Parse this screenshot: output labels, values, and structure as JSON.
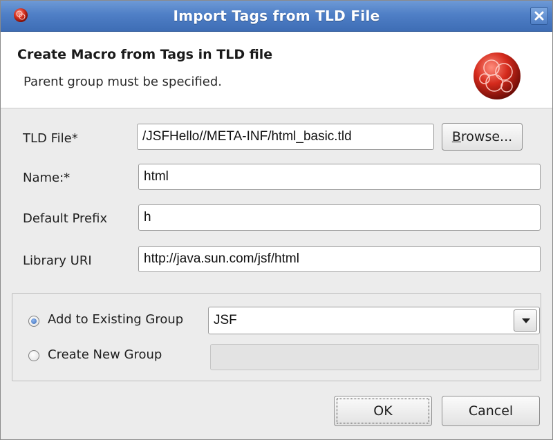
{
  "window": {
    "title": "Import Tags from TLD File"
  },
  "header": {
    "title": "Create Macro from Tags in TLD file",
    "message": "Parent group must be specified."
  },
  "form": {
    "tld_file": {
      "label": "TLD File*",
      "value": "/JSFHello//META-INF/html_basic.tld"
    },
    "browse_button": {
      "pre": "",
      "mnemonic": "B",
      "post": "rowse..."
    },
    "name": {
      "label": "Name:*",
      "value": "html"
    },
    "default_prefix": {
      "label": "Default Prefix",
      "value": "h"
    },
    "library_uri": {
      "label": "Library URI",
      "value": "http://java.sun.com/jsf/html"
    }
  },
  "group": {
    "existing": {
      "label": "Add to Existing Group",
      "selected": true,
      "value": "JSF"
    },
    "create_new": {
      "label": "Create New Group",
      "selected": false,
      "value": ""
    }
  },
  "buttons": {
    "ok": "OK",
    "cancel": "Cancel"
  },
  "icons": {
    "app": "eclipse-red-ball-icon",
    "close": "close-icon",
    "wizard": "wizard-banner-icon",
    "dropdown": "chevron-down-icon"
  },
  "colors": {
    "titlebar": "#4f7fc6",
    "accent_radio": "#3b6db8",
    "icon_red": "#c8281e"
  }
}
